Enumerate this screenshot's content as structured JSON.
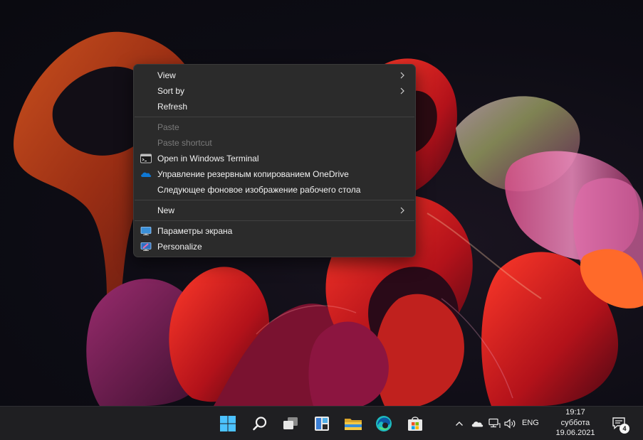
{
  "context_menu": {
    "items": [
      {
        "label": "View",
        "submenu": true,
        "enabled": true
      },
      {
        "label": "Sort by",
        "submenu": true,
        "enabled": true
      },
      {
        "label": "Refresh",
        "enabled": true
      },
      {
        "label": "Paste",
        "enabled": false
      },
      {
        "label": "Paste shortcut",
        "enabled": false
      },
      {
        "label": "Open in Windows Terminal",
        "icon": "terminal-icon",
        "enabled": true
      },
      {
        "label": "Управление резервным копированием OneDrive",
        "icon": "onedrive-cloud-icon",
        "enabled": true
      },
      {
        "label": "Следующее фоновое изображение рабочего стола",
        "enabled": true
      },
      {
        "label": "New",
        "submenu": true,
        "enabled": true
      },
      {
        "label": "Параметры экрана",
        "icon": "display-settings-icon",
        "enabled": true
      },
      {
        "label": "Personalize",
        "icon": "personalize-icon",
        "enabled": true
      }
    ]
  },
  "taskbar": {
    "pinned": [
      "start-icon",
      "search-icon",
      "task-view-icon",
      "widgets-icon",
      "file-explorer-icon",
      "edge-icon",
      "microsoft-store-icon"
    ],
    "tray_icons": [
      "chevron-up-icon",
      "onedrive-icon",
      "network-icon",
      "volume-icon"
    ],
    "language": "ENG",
    "clock": {
      "time": "19:17",
      "day": "суббота",
      "date": "19.06.2021"
    },
    "notifications_count": "4"
  },
  "colors": {
    "menu_bg": "#2b2b2b",
    "taskbar_bg": "#1f1f22",
    "onedrive_blue": "#0f78d4",
    "edge_teal": "#1ebbc0",
    "explorer_yellow": "#f2c94c"
  }
}
